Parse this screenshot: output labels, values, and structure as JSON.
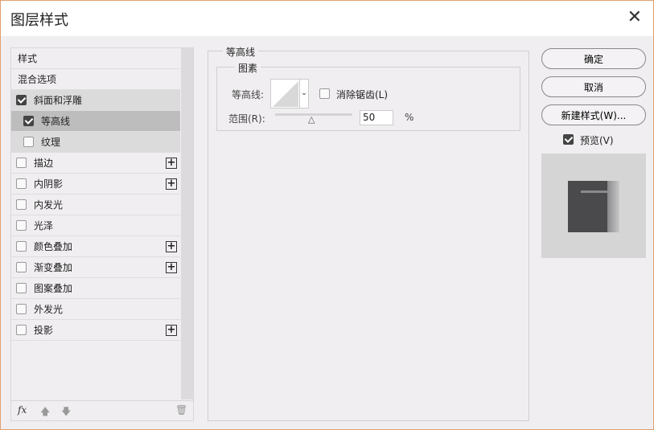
{
  "title": "图层样式",
  "sidebar": {
    "header": "样式",
    "items": [
      {
        "label": "混合选项"
      },
      {
        "label": "斜面和浮雕",
        "checked": true
      },
      {
        "label": "等高线",
        "checked": true,
        "selected": true
      },
      {
        "label": "纹理",
        "checked": false
      },
      {
        "label": "描边",
        "checked": false,
        "plus": true
      },
      {
        "label": "内阴影",
        "checked": false,
        "plus": true
      },
      {
        "label": "内发光",
        "checked": false
      },
      {
        "label": "光泽",
        "checked": false
      },
      {
        "label": "颜色叠加",
        "checked": false,
        "plus": true
      },
      {
        "label": "渐变叠加",
        "checked": false,
        "plus": true
      },
      {
        "label": "图案叠加",
        "checked": false
      },
      {
        "label": "外发光",
        "checked": false
      },
      {
        "label": "投影",
        "checked": false,
        "plus": true
      }
    ],
    "fx": "fx"
  },
  "panel": {
    "section": "等高线",
    "group": "图素",
    "contour_label": "等高线:",
    "antialias_label": "消除锯齿(L)",
    "antialias": false,
    "range_label": "范围(R):",
    "range_value": "50",
    "range_unit": "%"
  },
  "buttons": {
    "ok": "确定",
    "cancel": "取消",
    "new_style": "新建样式(W)..."
  },
  "preview": {
    "label": "预览(V)",
    "checked": true
  }
}
